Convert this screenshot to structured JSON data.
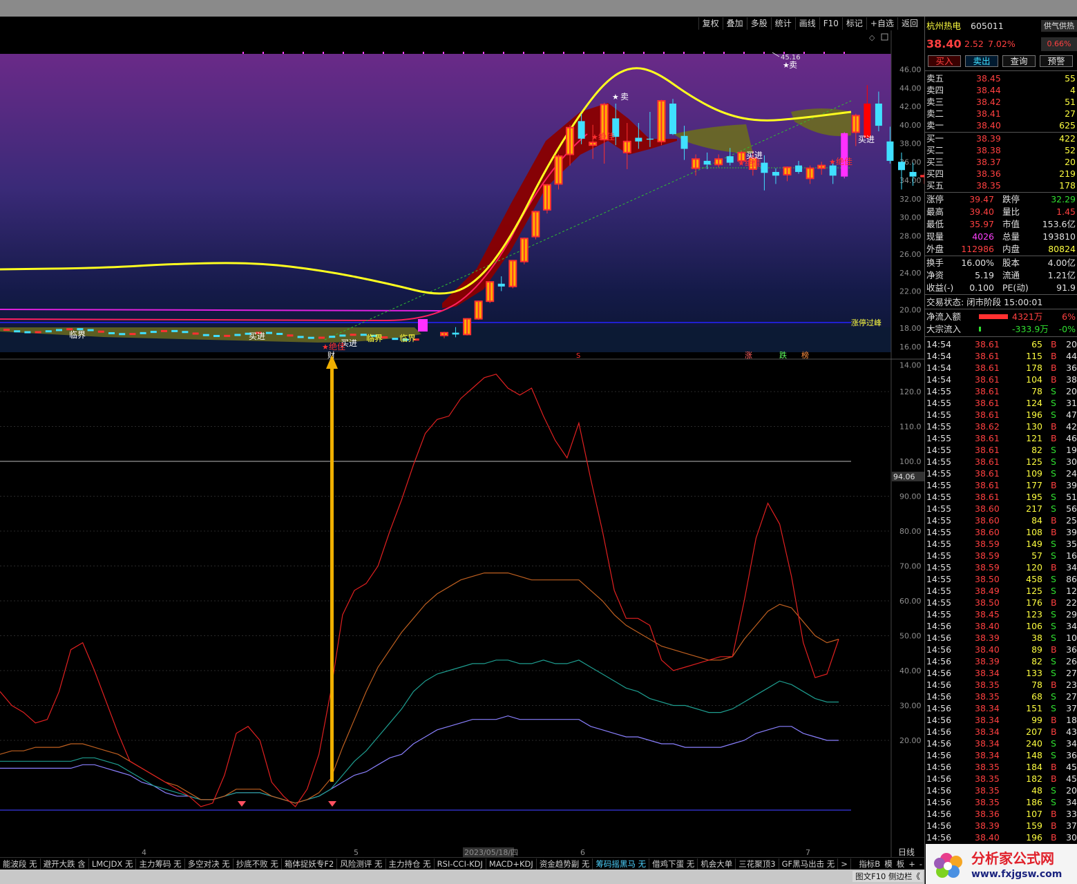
{
  "toolbar": {
    "items": [
      "复权",
      "叠加",
      "多股",
      "统计",
      "画线",
      "F10",
      "标记",
      "+自选",
      "返回"
    ]
  },
  "stock": {
    "name": "杭州热电",
    "code": "605011",
    "badge": "供气供热",
    "price": "38.40",
    "change": "2.52",
    "pct": "7.02%",
    "badge_pct": "0.66%",
    "actions": [
      "买入",
      "卖出",
      "查询",
      "预警"
    ]
  },
  "asks": [
    {
      "label": "卖五",
      "price": "38.45",
      "vol": "55"
    },
    {
      "label": "卖四",
      "price": "38.44",
      "vol": "4"
    },
    {
      "label": "卖三",
      "price": "38.42",
      "vol": "51"
    },
    {
      "label": "卖二",
      "price": "38.41",
      "vol": "27"
    },
    {
      "label": "卖一",
      "price": "38.40",
      "vol": "625"
    }
  ],
  "bids": [
    {
      "label": "买一",
      "price": "38.39",
      "vol": "422"
    },
    {
      "label": "买二",
      "price": "38.38",
      "vol": "52"
    },
    {
      "label": "买三",
      "price": "38.37",
      "vol": "20"
    },
    {
      "label": "买四",
      "price": "38.36",
      "vol": "219"
    },
    {
      "label": "买五",
      "price": "38.35",
      "vol": "178"
    }
  ],
  "stats": [
    {
      "l1": "涨停",
      "v1": "39.47",
      "l2": "跌停",
      "v2": "32.29"
    },
    {
      "l1": "最高",
      "v1": "39.40",
      "l2": "量比",
      "v2": "1.45"
    },
    {
      "l1": "最低",
      "v1": "35.97",
      "l2": "市值",
      "v2": "153.6亿"
    },
    {
      "l1": "现量",
      "v1": "4026",
      "l2": "总量",
      "v2": "193810"
    },
    {
      "l1": "外盘",
      "v1": "112986",
      "l2": "内盘",
      "v2": "80824"
    },
    {
      "l1": "换手",
      "v1": "16.00%",
      "l2": "股本",
      "v2": "4.00亿"
    },
    {
      "l1": "净资",
      "v1": "5.19",
      "l2": "流通",
      "v2": "1.21亿"
    },
    {
      "l1": "收益(-)",
      "v1": "0.100",
      "l2": "PE(动)",
      "v2": "91.9"
    }
  ],
  "trade_state": "交易状态: 闭市阶段 15:00:01",
  "netflow": {
    "label": "净流入额",
    "value": "4321万",
    "pct": "6%"
  },
  "blockflow": {
    "label": "大宗流入",
    "value": "-333.9万",
    "pct": "-0%"
  },
  "ticks": [
    [
      "14:54",
      "38.61",
      "65",
      "B",
      "20"
    ],
    [
      "14:54",
      "38.61",
      "115",
      "B",
      "44"
    ],
    [
      "14:54",
      "38.61",
      "178",
      "B",
      "36"
    ],
    [
      "14:54",
      "38.61",
      "104",
      "B",
      "38"
    ],
    [
      "14:55",
      "38.61",
      "78",
      "S",
      "20"
    ],
    [
      "14:55",
      "38.61",
      "124",
      "S",
      "31"
    ],
    [
      "14:55",
      "38.61",
      "196",
      "S",
      "47"
    ],
    [
      "14:55",
      "38.62",
      "130",
      "B",
      "42"
    ],
    [
      "14:55",
      "38.61",
      "121",
      "B",
      "46"
    ],
    [
      "14:55",
      "38.61",
      "82",
      "S",
      "19"
    ],
    [
      "14:55",
      "38.61",
      "125",
      "S",
      "30"
    ],
    [
      "14:55",
      "38.61",
      "109",
      "S",
      "24"
    ],
    [
      "14:55",
      "38.61",
      "177",
      "B",
      "39"
    ],
    [
      "14:55",
      "38.61",
      "195",
      "S",
      "51"
    ],
    [
      "14:55",
      "38.60",
      "217",
      "S",
      "56"
    ],
    [
      "14:55",
      "38.60",
      "84",
      "B",
      "25"
    ],
    [
      "14:55",
      "38.60",
      "108",
      "B",
      "39"
    ],
    [
      "14:55",
      "38.59",
      "149",
      "S",
      "35"
    ],
    [
      "14:55",
      "38.59",
      "57",
      "S",
      "16"
    ],
    [
      "14:55",
      "38.59",
      "120",
      "B",
      "34"
    ],
    [
      "14:55",
      "38.50",
      "458",
      "S",
      "86"
    ],
    [
      "14:55",
      "38.49",
      "125",
      "S",
      "12"
    ],
    [
      "14:55",
      "38.50",
      "176",
      "B",
      "22"
    ],
    [
      "14:55",
      "38.45",
      "123",
      "S",
      "29"
    ],
    [
      "14:56",
      "38.40",
      "106",
      "S",
      "34"
    ],
    [
      "14:56",
      "38.39",
      "38",
      "S",
      "10"
    ],
    [
      "14:56",
      "38.40",
      "89",
      "B",
      "36"
    ],
    [
      "14:56",
      "38.39",
      "82",
      "S",
      "26"
    ],
    [
      "14:56",
      "38.34",
      "133",
      "S",
      "27"
    ],
    [
      "14:56",
      "38.35",
      "78",
      "B",
      "23"
    ],
    [
      "14:56",
      "38.35",
      "68",
      "S",
      "27"
    ],
    [
      "14:56",
      "38.34",
      "151",
      "S",
      "37"
    ],
    [
      "14:56",
      "38.34",
      "99",
      "B",
      "18"
    ],
    [
      "14:56",
      "38.34",
      "207",
      "B",
      "43"
    ],
    [
      "14:56",
      "38.34",
      "240",
      "S",
      "34"
    ],
    [
      "14:56",
      "38.34",
      "148",
      "S",
      "36"
    ],
    [
      "14:56",
      "38.35",
      "184",
      "B",
      "45"
    ],
    [
      "14:56",
      "38.35",
      "182",
      "B",
      "45"
    ],
    [
      "14:56",
      "38.35",
      "48",
      "S",
      "20"
    ],
    [
      "14:56",
      "38.35",
      "186",
      "S",
      "34"
    ],
    [
      "14:56",
      "38.36",
      "107",
      "B",
      "33"
    ],
    [
      "14:56",
      "38.39",
      "159",
      "B",
      "37"
    ],
    [
      "14:56",
      "38.40",
      "196",
      "B",
      "30"
    ]
  ],
  "chart": {
    "price_axis": [
      "46.00",
      "44.00",
      "42.00",
      "40.00",
      "38.00",
      "36.00",
      "34.00",
      "32.00",
      "30.00",
      "28.00",
      "26.00",
      "24.00",
      "22.00",
      "20.00",
      "18.00",
      "16.00",
      "14.00"
    ],
    "ind_axis": [
      "120.0",
      "110.0",
      "100.0",
      "90.00",
      "80.00",
      "70.00",
      "60.00",
      "50.00",
      "40.00",
      "30.00",
      "20.00"
    ],
    "current_ind": "94.06",
    "high_label": "45.16",
    "limit_label": "涨停过峰",
    "signals": {
      "buy": "买进",
      "sell": "卖",
      "best": "绝佳",
      "critical": "临界",
      "cai": "财",
      "zhang": "涨",
      "die": "跌",
      "bang": "榜",
      "s_mark": "S"
    },
    "date_labels": [
      "4",
      "5",
      "2023/05/18/四",
      "6",
      "7"
    ],
    "period": "日线",
    "candles": [
      [
        17.2,
        17.6,
        16.9,
        17.5
      ],
      [
        17.5,
        18.1,
        17.0,
        17.3
      ],
      [
        17.3,
        19.0,
        17.2,
        19.0
      ],
      [
        19.0,
        20.9,
        18.9,
        20.9
      ],
      [
        20.9,
        23.0,
        20.7,
        23.0
      ],
      [
        22.8,
        23.6,
        22.0,
        22.5
      ],
      [
        22.5,
        25.3,
        22.3,
        25.3
      ],
      [
        25.2,
        27.8,
        24.9,
        27.7
      ],
      [
        27.9,
        30.7,
        27.6,
        30.6
      ],
      [
        30.8,
        33.6,
        30.4,
        33.5
      ],
      [
        33.6,
        36.8,
        33.0,
        36.6
      ],
      [
        36.8,
        40.0,
        35.6,
        39.7
      ],
      [
        40.4,
        41.2,
        37.9,
        38.5
      ],
      [
        37.8,
        40.0,
        36.3,
        38.1
      ],
      [
        38.4,
        42.4,
        35.8,
        42.2
      ],
      [
        40.7,
        42.3,
        37.8,
        38.7
      ],
      [
        37.0,
        40.2,
        35.2,
        38.2
      ],
      [
        38.6,
        40.2,
        37.4,
        38.2
      ],
      [
        38.5,
        41.4,
        37.6,
        38.4
      ],
      [
        38.2,
        42.7,
        37.8,
        42.6
      ],
      [
        42.3,
        42.8,
        38.9,
        39.0
      ],
      [
        38.8,
        39.9,
        36.2,
        37.4
      ],
      [
        35.3,
        36.8,
        34.5,
        36.3
      ],
      [
        36.1,
        37.0,
        35.2,
        35.7
      ],
      [
        35.7,
        36.8,
        35.4,
        36.3
      ],
      [
        36.6,
        37.5,
        35.6,
        35.9
      ],
      [
        36.1,
        37.2,
        35.7,
        37.0
      ],
      [
        35.2,
        37.2,
        34.5,
        36.4
      ],
      [
        35.9,
        36.7,
        32.9,
        34.8
      ],
      [
        34.9,
        35.3,
        33.6,
        34.5
      ],
      [
        34.6,
        35.5,
        33.9,
        35.4
      ],
      [
        35.6,
        36.1,
        34.7,
        34.9
      ],
      [
        34.2,
        35.6,
        33.6,
        35.3
      ],
      [
        35.3,
        36.0,
        34.6,
        35.6
      ],
      [
        35.6,
        36.1,
        33.6,
        34.5
      ],
      [
        34.4,
        39.2,
        34.2,
        39.1
      ],
      [
        39.2,
        41.2,
        37.7,
        41.0
      ],
      [
        38.6,
        44.3,
        38.5,
        42.3
      ],
      [
        42.3,
        43.6,
        39.3,
        39.9
      ],
      [
        38.2,
        39.8,
        35.8,
        36.1
      ],
      [
        36.0,
        37.0,
        33.0,
        35.1
      ],
      [
        34.9,
        35.9,
        33.4,
        34.4
      ],
      [
        34.4,
        34.8,
        33.6,
        34.5
      ],
      [
        34.6,
        36.1,
        34.4,
        36.0
      ],
      [
        35.8,
        36.7,
        35.5,
        36.3
      ],
      [
        36.7,
        39.0,
        36.5,
        38.4
      ]
    ],
    "ind_red": [
      34,
      30,
      28,
      25,
      26,
      34,
      46,
      48,
      40,
      31,
      22,
      14,
      12,
      10,
      8,
      6,
      4,
      1,
      2,
      10,
      22,
      24,
      20,
      8,
      4,
      1,
      6,
      16,
      34,
      56,
      63,
      65,
      70,
      80,
      89,
      99,
      108,
      112,
      113,
      118,
      121,
      124,
      125,
      121,
      119,
      121,
      113,
      106,
      101,
      111,
      95,
      80,
      63,
      55,
      55,
      53,
      43,
      40,
      41,
      42,
      43,
      44,
      44,
      60,
      78,
      88,
      82,
      67,
      48,
      38,
      39,
      49
    ],
    "ind_orange": [
      16,
      17,
      17,
      18,
      18,
      18,
      19,
      19,
      18,
      17,
      16,
      14,
      12,
      10,
      8,
      7,
      5,
      3,
      3,
      4,
      6,
      6,
      6,
      4,
      3,
      2,
      3,
      5,
      9,
      18,
      26,
      34,
      41,
      46,
      51,
      55,
      59,
      62,
      64,
      66,
      67,
      68,
      68,
      68,
      67,
      66,
      66,
      66,
      66,
      66,
      63,
      60,
      56,
      53,
      51,
      49,
      47,
      46,
      45,
      44,
      43,
      43,
      44,
      49,
      53,
      57,
      59,
      58,
      54,
      50,
      48,
      49
    ],
    "ind_teal": [
      14,
      14,
      14,
      14,
      14,
      14,
      14,
      15,
      15,
      14,
      13,
      11,
      9,
      7,
      6,
      5,
      4,
      3,
      3,
      4,
      5,
      5,
      5,
      4,
      3,
      2,
      3,
      4,
      6,
      10,
      14,
      17,
      21,
      25,
      29,
      34,
      37,
      39,
      40,
      41,
      42,
      42,
      43,
      43,
      42,
      42,
      43,
      42,
      42,
      43,
      41,
      39,
      37,
      35,
      34,
      32,
      31,
      30,
      30,
      29,
      28,
      28,
      29,
      31,
      33,
      35,
      37,
      36,
      34,
      32,
      31,
      31
    ],
    "ind_violet": [
      12,
      12,
      12,
      12,
      12,
      12,
      12,
      13,
      13,
      12,
      11,
      10,
      8,
      7,
      5,
      4,
      4,
      3,
      3,
      4,
      5,
      5,
      5,
      4,
      3,
      2,
      3,
      4,
      6,
      8,
      10,
      11,
      13,
      15,
      16,
      19,
      21,
      23,
      24,
      25,
      26,
      26,
      26,
      27,
      26,
      26,
      26,
      26,
      26,
      26,
      24,
      23,
      22,
      21,
      21,
      20,
      19,
      19,
      18,
      18,
      18,
      18,
      19,
      20,
      22,
      23,
      24,
      24,
      22,
      21,
      20,
      20
    ]
  },
  "tabs": [
    "能波段 无",
    "避开大跌 含",
    "LMCJDX 无",
    "主力筹码 无",
    "多空对决 无",
    "抄底不败 无",
    "箱体捉妖专F2",
    "风险测评 无",
    "主力持仓 无",
    "RSI-CCI-KDJ",
    "MACD+KDJ",
    "资金趋势副 无",
    "筹码摇黑马 无",
    "借鸡下蛋 无",
    "机会大单",
    "三花聚顶3",
    "GF黑马出击 无"
  ],
  "tabs_right": [
    "指标B",
    "模",
    "板",
    "+",
    "-"
  ],
  "bottom_btn": "图文F10 侧边栏《",
  "logo": {
    "text": "分析家公式网",
    "url": "www.fxjgsw.com"
  }
}
